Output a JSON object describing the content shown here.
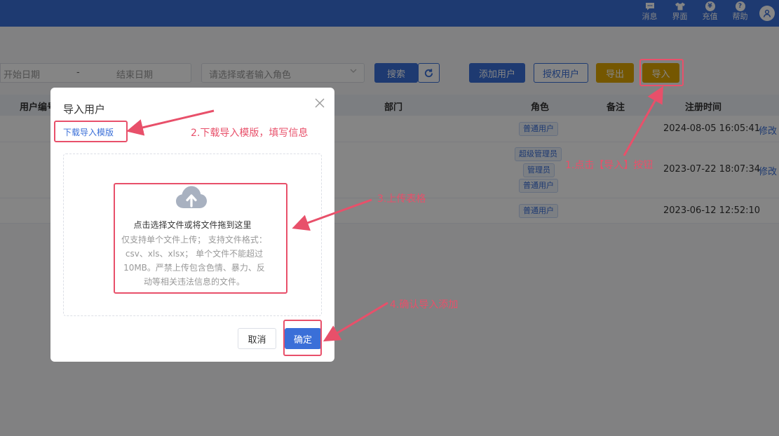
{
  "topbar": {
    "icons": [
      {
        "icon": "message-icon",
        "label": "消息"
      },
      {
        "icon": "theme-icon",
        "label": "界面"
      },
      {
        "icon": "yen-icon",
        "label": "充值"
      },
      {
        "icon": "help-icon",
        "label": "帮助"
      }
    ],
    "help_glyph": "?",
    "yen_glyph": "¥"
  },
  "filters": {
    "start_date_placeholder": "开始日期",
    "range_separator": "-",
    "end_date_placeholder": "结束日期",
    "role_placeholder": "请选择或者输入角色",
    "search_label": "搜索",
    "add_user_label": "添加用户",
    "auth_user_label": "授权用户",
    "export_label": "导出",
    "import_label": "导入"
  },
  "table": {
    "headers": {
      "user_no": "用户编号",
      "dept": "部门",
      "role": "角色",
      "remark": "备注",
      "reg_time": "注册时间"
    },
    "rows": [
      {
        "roles": [
          "普通用户"
        ],
        "reg_time": "2024-08-05 16:05:41",
        "action": "修改"
      },
      {
        "roles": [
          "超级管理员",
          "管理员",
          "普通用户"
        ],
        "reg_time": "2023-07-22 18:07:34",
        "action": "修改"
      },
      {
        "roles": [
          "普通用户"
        ],
        "reg_time": "2023-06-12 12:52:10",
        "action": ""
      }
    ]
  },
  "modal": {
    "title": "导入用户",
    "template_link": "下载导入模版",
    "drop_main": "点击选择文件或将文件拖到这里",
    "drop_hint": "仅支持单个文件上传； 支持文件格式：csv、xls、xlsx； 单个文件不能超过10MB。严禁上传包含色情、暴力、反动等相关违法信息的文件。",
    "cancel_label": "取消",
    "ok_label": "确定"
  },
  "annotations": {
    "step1": "1.点击【导入】按钮",
    "step2": "2.下载导入模版，填写信息",
    "step3": "3.上传表格",
    "step4": "4.确认导入添加"
  },
  "colors": {
    "primary": "#3a6fd8",
    "gold": "#e0a800",
    "annotation": "#e8506a"
  }
}
